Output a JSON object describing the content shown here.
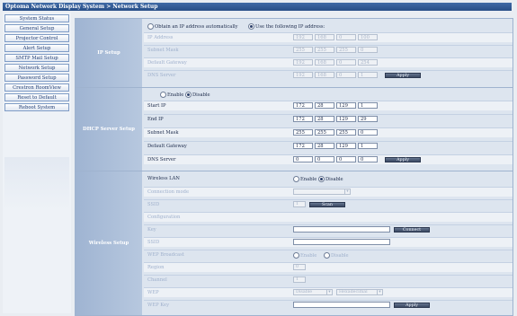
{
  "window": {
    "title": "Optoma Network Display System > Network Setup"
  },
  "sidebar": {
    "items": [
      {
        "label": "System Status"
      },
      {
        "label": "General Setup"
      },
      {
        "label": "Projector Control"
      },
      {
        "label": "Alert Setup"
      },
      {
        "label": "SMTP Mail Setup"
      },
      {
        "label": "Network Setup"
      },
      {
        "label": "Password Setup"
      },
      {
        "label": "Crestron RoomView"
      },
      {
        "label": "Reset to Default"
      },
      {
        "label": "Reboot System"
      }
    ]
  },
  "ip_setup": {
    "section_label": "IP Setup",
    "option_auto": "Obtain an IP address automatically",
    "option_manual": "Use the following IP address:",
    "fields": [
      {
        "label": "IP Address",
        "octets": [
          "192",
          "168",
          "0",
          "100"
        ]
      },
      {
        "label": "Subnet Mask",
        "octets": [
          "255",
          "255",
          "255",
          "0"
        ]
      },
      {
        "label": "Default Gateway",
        "octets": [
          "192",
          "168",
          "0",
          "254"
        ]
      },
      {
        "label": "DNS Server",
        "octets": [
          "192",
          "168",
          "0",
          "1"
        ]
      }
    ],
    "apply_label": "Apply"
  },
  "dhcp_setup": {
    "section_label": "DHCP Server Setup",
    "enable_label": "Enable",
    "disable_label": "Disable",
    "fields": [
      {
        "label": "Start IP",
        "octets": [
          "172",
          "28",
          "129",
          "1"
        ]
      },
      {
        "label": "End IP",
        "octets": [
          "172",
          "28",
          "129",
          "29"
        ]
      },
      {
        "label": "Subnet Mask",
        "octets": [
          "255",
          "255",
          "255",
          "0"
        ]
      },
      {
        "label": "Default Gateway",
        "octets": [
          "172",
          "28",
          "129",
          "1"
        ]
      },
      {
        "label": "DNS Server",
        "octets": [
          "0",
          "0",
          "0",
          "0"
        ]
      }
    ],
    "apply_label": "Apply"
  },
  "wireless_setup": {
    "section_label": "Wireless Setup",
    "wlan_label": "Wireless LAN",
    "enable_label": "Enable",
    "disable_label": "Disable",
    "rows": [
      {
        "label": "Connection mode"
      },
      {
        "label": "SSID",
        "value": "1"
      },
      {
        "label": "Configuration"
      },
      {
        "label": "Key"
      },
      {
        "label": "SSID"
      },
      {
        "label": "WEP Broadcast"
      },
      {
        "label": "Region",
        "value": "0"
      },
      {
        "label": "Channel",
        "value": "1"
      },
      {
        "label": "WEP"
      },
      {
        "label": "WEP Key"
      }
    ],
    "scan_label": "Scan",
    "connect_label": "Connect",
    "wep_broadcast_enable": "Enable",
    "wep_broadcast_disable": "Disable",
    "wep_select1": "Disable",
    "wep_select2": "Hexadecimal",
    "apply_label": "Apply"
  }
}
